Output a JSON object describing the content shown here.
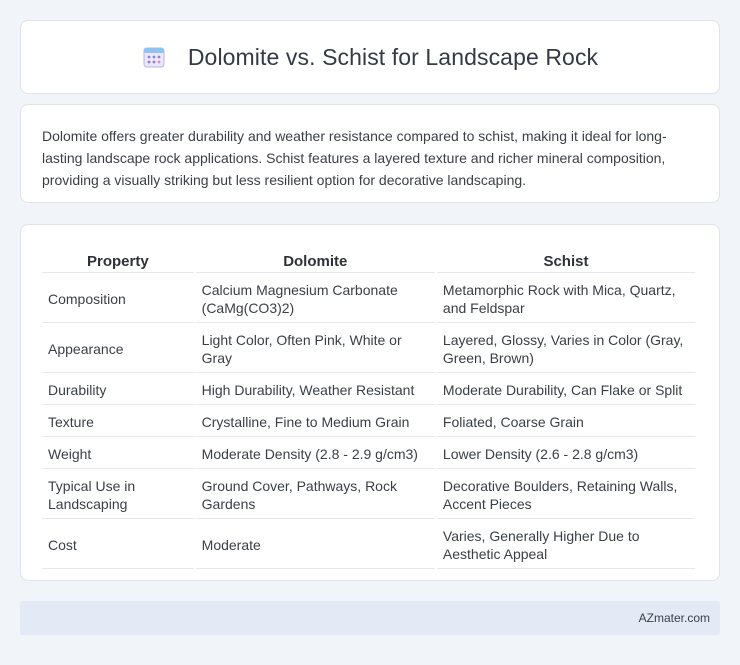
{
  "header": {
    "title": "Dolomite vs. Schist for Landscape Rock",
    "icon": "calendar-grid-icon"
  },
  "summary": {
    "text": "Dolomite offers greater durability and weather resistance compared to schist, making it ideal for long-lasting landscape rock applications. Schist features a layered texture and richer mineral composition, providing a visually striking but less resilient option for decorative landscaping."
  },
  "table": {
    "headers": [
      "Property",
      "Dolomite",
      "Schist"
    ],
    "rows": [
      [
        "Composition",
        "Calcium Magnesium Carbonate (CaMg(CO3)2)",
        "Metamorphic Rock with Mica, Quartz, and Feldspar"
      ],
      [
        "Appearance",
        "Light Color, Often Pink, White or Gray",
        "Layered, Glossy, Varies in Color (Gray, Green, Brown)"
      ],
      [
        "Durability",
        "High Durability, Weather Resistant",
        "Moderate Durability, Can Flake or Split"
      ],
      [
        "Texture",
        "Crystalline, Fine to Medium Grain",
        "Foliated, Coarse Grain"
      ],
      [
        "Weight",
        "Moderate Density (2.8 - 2.9 g/cm3)",
        "Lower Density (2.6 - 2.8 g/cm3)"
      ],
      [
        "Typical Use in Landscaping",
        "Ground Cover, Pathways, Rock Gardens",
        "Decorative Boulders, Retaining Walls, Accent Pieces"
      ],
      [
        "Cost",
        "Moderate",
        "Varies, Generally Higher Due to Aesthetic Appeal"
      ]
    ]
  },
  "footer": {
    "text": "AZmater.com"
  },
  "colors": {
    "background": "#f1f4f8",
    "card": "#ffffff",
    "footer_bar": "#e4eaf5",
    "icon_accent": "#8b7fd6"
  }
}
